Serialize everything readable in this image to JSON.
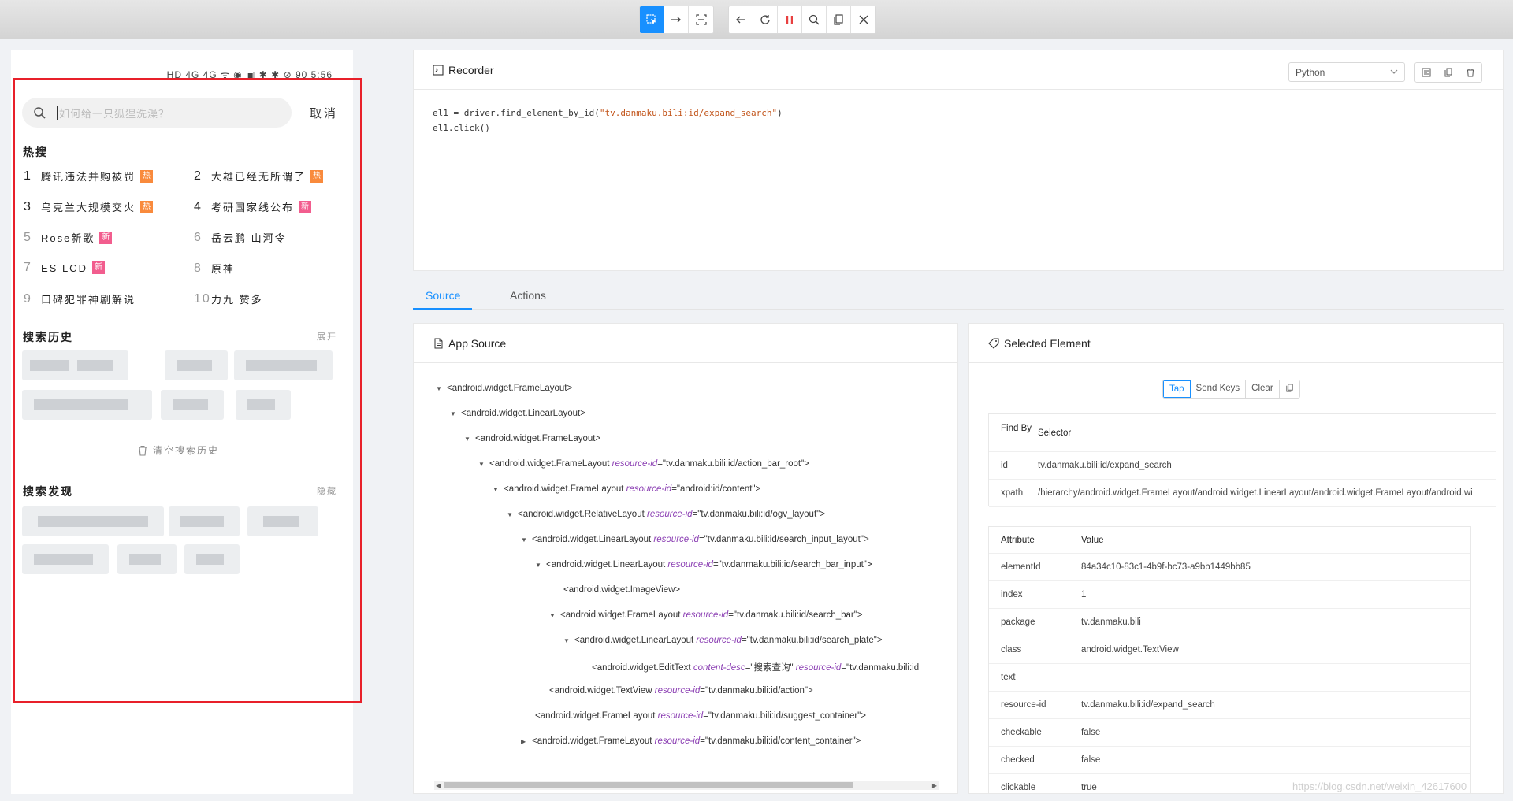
{
  "toolbar": {
    "left_group": [
      "select-element-icon",
      "swipe-icon",
      "tap-coordinates-icon"
    ],
    "right_group": [
      "back-icon",
      "refresh-icon",
      "pause-recording-icon",
      "search-icon",
      "copy-xml-icon",
      "quit-session-icon"
    ],
    "active": "select-element-icon",
    "accent": "#1890ff"
  },
  "device": {
    "status_bar": "HD 4G 4G ᯤ ◉ ▣   ✱ ✱ ⊘ 90 5:56",
    "search_placeholder": "如何给一只狐狸洗澡？",
    "cancel": "取消",
    "hot_title": "热搜",
    "hot_items": [
      {
        "num": "1",
        "text": "腾讯违法并购被罚",
        "badge": "热"
      },
      {
        "num": "2",
        "text": "大雄已经无所谓了",
        "badge": "热"
      },
      {
        "num": "3",
        "text": "乌克兰大规模交火",
        "badge": "热"
      },
      {
        "num": "4",
        "text": "考研国家线公布",
        "badge": "新"
      },
      {
        "num": "5",
        "text": "Rose新歌",
        "badge": "新"
      },
      {
        "num": "6",
        "text": "岳云鹏 山河令",
        "badge": ""
      },
      {
        "num": "7",
        "text": "ES LCD",
        "badge": "新"
      },
      {
        "num": "8",
        "text": "原神",
        "badge": ""
      },
      {
        "num": "9",
        "text": "口碑犯罪神剧解说",
        "badge": ""
      },
      {
        "num": "10",
        "text": "力九 赞多",
        "badge": ""
      }
    ],
    "history_title": "搜索历史",
    "history_action": "展开",
    "clear_history": "清空搜索历史",
    "discover_title": "搜索发现",
    "discover_action": "隐藏",
    "colors": {
      "hot": "#f98a3c",
      "new": "#f25d8e"
    }
  },
  "recorder": {
    "title": "Recorder",
    "language": "Python",
    "code_line1_pre": "el1 = driver.find_element_by_id(",
    "code_line1_str": "\"tv.danmaku.bili:id/expand_search\"",
    "code_line1_post": ")",
    "code_line2": "el1.click()"
  },
  "tabs": [
    "Source",
    "Actions"
  ],
  "app_source": {
    "title": "App Source",
    "nodes": [
      {
        "toggle": "▼",
        "tag": "<android.widget.FrameLayout>",
        "attrs": []
      },
      {
        "toggle": "▼",
        "tag": "<android.widget.LinearLayout>",
        "attrs": []
      },
      {
        "toggle": "▼",
        "tag": "<android.widget.FrameLayout>",
        "attrs": []
      },
      {
        "toggle": "▼",
        "tag": "<android.widget.FrameLayout",
        "attrs": [
          {
            "name": "resource-id",
            "value": "\"tv.danmaku.bili:id/action_bar_root\""
          }
        ],
        "close": ">"
      },
      {
        "toggle": "▼",
        "tag": "<android.widget.FrameLayout",
        "attrs": [
          {
            "name": "resource-id",
            "value": "\"android:id/content\""
          }
        ],
        "close": ">"
      },
      {
        "toggle": "▼",
        "tag": "<android.widget.RelativeLayout",
        "attrs": [
          {
            "name": "resource-id",
            "value": "\"tv.danmaku.bili:id/ogv_layout\""
          }
        ],
        "close": ">"
      },
      {
        "toggle": "▼",
        "tag": "<android.widget.LinearLayout",
        "attrs": [
          {
            "name": "resource-id",
            "value": "\"tv.danmaku.bili:id/search_input_layout\""
          }
        ],
        "close": ">"
      },
      {
        "toggle": "▼",
        "tag": "<android.widget.LinearLayout",
        "attrs": [
          {
            "name": "resource-id",
            "value": "\"tv.danmaku.bili:id/search_bar_input\""
          }
        ],
        "close": ">"
      },
      {
        "toggle": "",
        "tag": "<android.widget.ImageView>",
        "attrs": []
      },
      {
        "toggle": "▼",
        "tag": "<android.widget.FrameLayout",
        "attrs": [
          {
            "name": "resource-id",
            "value": "\"tv.danmaku.bili:id/search_bar\""
          }
        ],
        "close": ">"
      },
      {
        "toggle": "▼",
        "tag": "<android.widget.LinearLayout",
        "attrs": [
          {
            "name": "resource-id",
            "value": "\"tv.danmaku.bili:id/search_plate\""
          }
        ],
        "close": ">"
      },
      {
        "toggle": "",
        "tag": "<android.widget.EditText",
        "attrs": [
          {
            "name": "content-desc",
            "value": "\"搜索查询\""
          },
          {
            "name": "resource-id",
            "value": "\"tv.danmaku.bili:id"
          }
        ],
        "close": ""
      },
      {
        "toggle": "",
        "tag": "<android.widget.TextView",
        "attrs": [
          {
            "name": "resource-id",
            "value": "\"tv.danmaku.bili:id/action\""
          }
        ],
        "close": ">"
      },
      {
        "toggle": "",
        "tag": "<android.widget.FrameLayout",
        "attrs": [
          {
            "name": "resource-id",
            "value": "\"tv.danmaku.bili:id/suggest_container\""
          }
        ],
        "close": ">"
      },
      {
        "toggle": "▶",
        "tag": "<android.widget.FrameLayout",
        "attrs": [
          {
            "name": "resource-id",
            "value": "\"tv.danmaku.bili:id/content_container\""
          }
        ],
        "close": ">"
      }
    ]
  },
  "selected": {
    "title": "Selected Element",
    "buttons": [
      "Tap",
      "Send Keys",
      "Clear"
    ],
    "find_by_header": [
      "Find By",
      "Selector"
    ],
    "find_by": [
      {
        "by": "id",
        "selector": "tv.danmaku.bili:id/expand_search"
      },
      {
        "by": "xpath",
        "selector": "/hierarchy/android.widget.FrameLayout/android.widget.LinearLayout/android.widget.FrameLayout/android.wi"
      }
    ],
    "attr_header": [
      "Attribute",
      "Value"
    ],
    "attributes": [
      {
        "name": "elementId",
        "value": "84a34c10-83c1-4b9f-bc73-a9bb1449bb85"
      },
      {
        "name": "index",
        "value": "1"
      },
      {
        "name": "package",
        "value": "tv.danmaku.bili"
      },
      {
        "name": "class",
        "value": "android.widget.TextView"
      },
      {
        "name": "text",
        "value": ""
      },
      {
        "name": "resource-id",
        "value": "tv.danmaku.bili:id/expand_search"
      },
      {
        "name": "checkable",
        "value": "false"
      },
      {
        "name": "checked",
        "value": "false"
      },
      {
        "name": "clickable",
        "value": "true"
      }
    ]
  },
  "watermark": "https://blog.csdn.net/weixin_42617600"
}
